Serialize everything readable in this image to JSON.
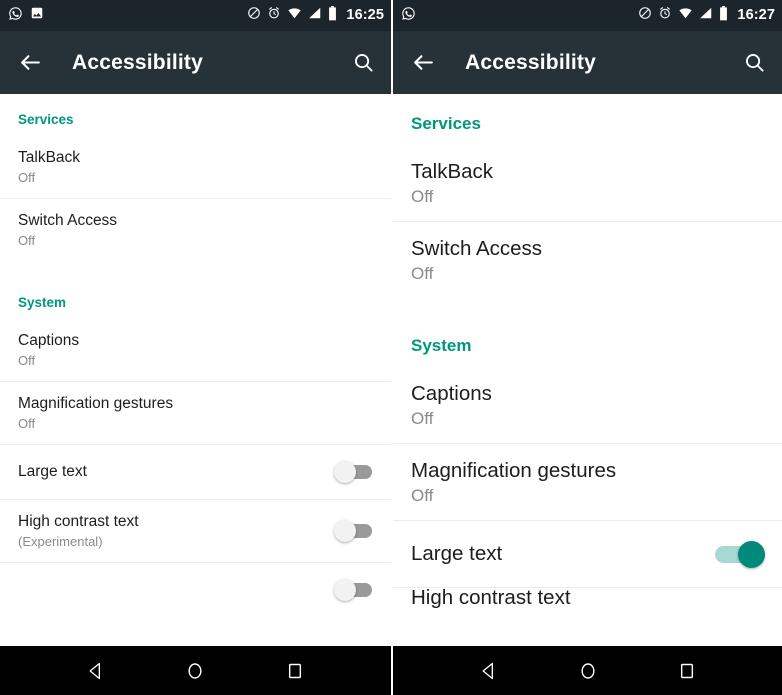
{
  "panels": [
    {
      "id": "left",
      "variant": "normal-text",
      "statusbar": {
        "time": "16:25",
        "left_icons": [
          "whatsapp-icon",
          "photo-icon"
        ],
        "right_icons": [
          "do-not-disturb-icon",
          "alarm-icon",
          "wifi-icon",
          "signal-icon",
          "battery-icon"
        ]
      },
      "toolbar": {
        "back_label": "back-arrow",
        "title": "Accessibility",
        "search_label": "search"
      },
      "sections": [
        {
          "header": "Services",
          "items": [
            {
              "title": "TalkBack",
              "sub": "Off",
              "toggle": null
            },
            {
              "title": "Switch Access",
              "sub": "Off",
              "toggle": null
            }
          ]
        },
        {
          "header": "System",
          "items": [
            {
              "title": "Captions",
              "sub": "Off",
              "toggle": null
            },
            {
              "title": "Magnification gestures",
              "sub": "Off",
              "toggle": null
            },
            {
              "title": "Large text",
              "sub": "",
              "toggle": "off"
            },
            {
              "title": "High contrast text",
              "sub": "(Experimental)",
              "toggle": "off"
            }
          ]
        }
      ],
      "navbar": {
        "back": "back-triangle",
        "home": "home-circle",
        "recents": "recents-square"
      }
    },
    {
      "id": "right",
      "variant": "large-text",
      "statusbar": {
        "time": "16:27",
        "left_icons": [
          "whatsapp-icon"
        ],
        "right_icons": [
          "do-not-disturb-icon",
          "alarm-icon",
          "wifi-icon",
          "signal-icon",
          "battery-icon"
        ]
      },
      "toolbar": {
        "back_label": "back-arrow",
        "title": "Accessibility",
        "search_label": "search"
      },
      "sections": [
        {
          "header": "Services",
          "items": [
            {
              "title": "TalkBack",
              "sub": "Off",
              "toggle": null
            },
            {
              "title": "Switch Access",
              "sub": "Off",
              "toggle": null
            }
          ]
        },
        {
          "header": "System",
          "items": [
            {
              "title": "Captions",
              "sub": "Off",
              "toggle": null
            },
            {
              "title": "Magnification gestures",
              "sub": "Off",
              "toggle": null
            },
            {
              "title": "Large text",
              "sub": "",
              "toggle": "on"
            },
            {
              "title": "High contrast text",
              "sub": "",
              "toggle": "off"
            }
          ]
        }
      ],
      "navbar": {
        "back": "back-triangle",
        "home": "home-circle",
        "recents": "recents-square"
      }
    }
  ],
  "colors": {
    "statusbar_bg": "#1d252c",
    "toolbar_bg": "#273238",
    "section_header": "#00977f",
    "toggle_on": "#01897b",
    "toggle_off_track": "#9a9a9a",
    "navbar_bg": "#000000",
    "title_text": "#1d1d1d",
    "sub_text": "#8a8a8a"
  }
}
